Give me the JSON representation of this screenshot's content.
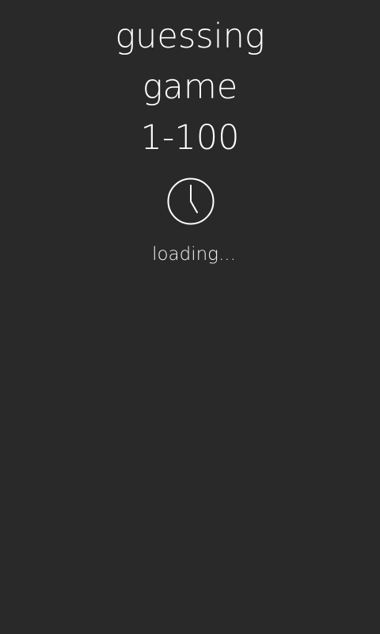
{
  "app": {
    "title_lines": [
      "guessing",
      "game",
      "1-100"
    ]
  },
  "status": {
    "text": "loading...",
    "icon": "clock-icon"
  },
  "colors": {
    "background": "#292929",
    "foreground": "#ffffff"
  }
}
